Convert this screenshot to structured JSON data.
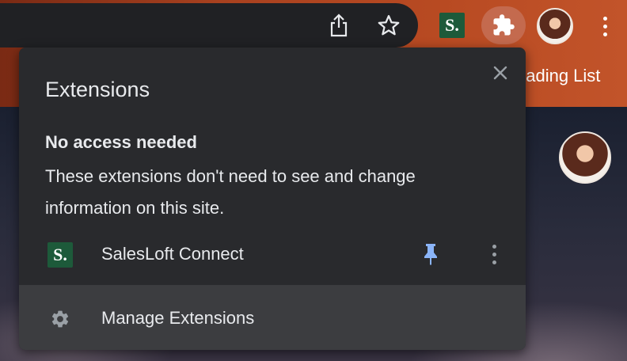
{
  "toolbar": {
    "share_icon": "share-icon",
    "bookmark_icon": "star-icon",
    "pinned_extension": {
      "glyph": "S.",
      "color": "#1d5a3a"
    },
    "extensions_icon": "puzzle-icon",
    "more_icon": "more-vertical-icon"
  },
  "bookmarks_bar": {
    "reading_list_label": "eading List"
  },
  "popup": {
    "title": "Extensions",
    "close_icon": "close-icon",
    "section": {
      "heading": "No access needed",
      "description": "These extensions don't need to see and change information on this site."
    },
    "extensions": [
      {
        "name": "SalesLoft Connect",
        "glyph": "S.",
        "pinned": true,
        "pin_color": "#8ab4f8"
      }
    ],
    "manage_label": "Manage Extensions"
  },
  "colors": {
    "popup_bg": "#292a2d",
    "manage_bg": "#3c3d40",
    "accent_pin": "#8ab4f8",
    "toolbar_bg": "#b84a22"
  }
}
